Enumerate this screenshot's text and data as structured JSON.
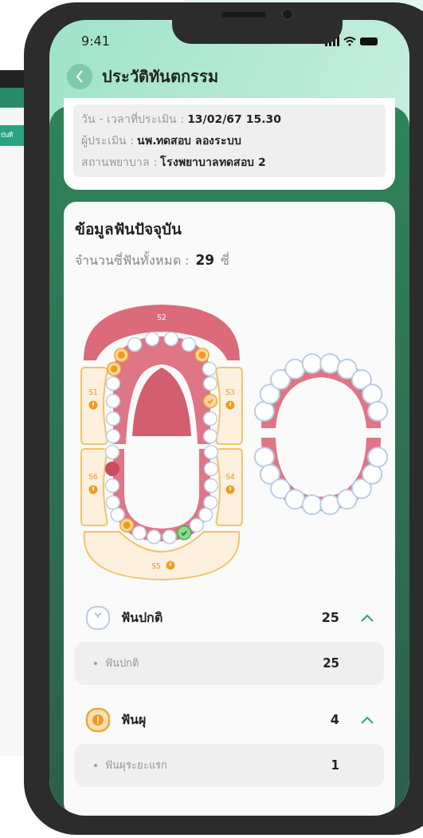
{
  "background_device": {
    "button_label": "บันทึ"
  },
  "status_bar": {
    "time": "9:41"
  },
  "header": {
    "title": "ประวัติทันตกรรม"
  },
  "info": [
    {
      "label": "วัน - เวลาที่ประเมิน :",
      "value": "13/02/67 15.30"
    },
    {
      "label": "ผู้ประเมิน :",
      "value": "นพ.ทดสอบ ลองระบบ"
    },
    {
      "label": "สถานพยาบาล :",
      "value": "โรงพยาบาลทดสอบ 2"
    }
  ],
  "teeth_card": {
    "title": "ข้อมูลฟันปัจจุบัน",
    "count_label": "จำนวนซี่ฟันทั้งหมด :",
    "count": "29",
    "unit": "ซี่"
  },
  "chart": {
    "segments": [
      {
        "label": "S2",
        "kind": "filled",
        "alert": false
      },
      {
        "label": "S1",
        "kind": "outline",
        "alert": true
      },
      {
        "label": "S3",
        "kind": "outline",
        "alert": true
      },
      {
        "label": "S6",
        "kind": "outline",
        "alert": true
      },
      {
        "label": "S4",
        "kind": "outline",
        "alert": true
      },
      {
        "label": "S5",
        "kind": "outline",
        "alert": true
      }
    ],
    "upper": [
      {
        "kind": "normal"
      },
      {
        "kind": "normal"
      },
      {
        "kind": "normal"
      },
      {
        "kind": "normal"
      },
      {
        "kind": "caries"
      },
      {
        "kind": "caries"
      },
      {
        "kind": "normal"
      },
      {
        "kind": "normal"
      },
      {
        "kind": "normal"
      },
      {
        "kind": "normal"
      },
      {
        "kind": "caries"
      },
      {
        "kind": "normal"
      },
      {
        "kind": "normal"
      },
      {
        "kind": "treated"
      },
      {
        "kind": "normal"
      },
      {
        "kind": "normal"
      }
    ],
    "lower": [
      {
        "kind": "normal"
      },
      {
        "kind": "missing"
      },
      {
        "kind": "normal"
      },
      {
        "kind": "normal"
      },
      {
        "kind": "normal"
      },
      {
        "kind": "caries"
      },
      {
        "kind": "normal"
      },
      {
        "kind": "normal"
      },
      {
        "kind": "normal"
      },
      {
        "kind": "sealed"
      },
      {
        "kind": "normal"
      },
      {
        "kind": "normal"
      },
      {
        "kind": "normal"
      },
      {
        "kind": "normal"
      },
      {
        "kind": "normal"
      },
      {
        "kind": "normal"
      }
    ]
  },
  "groups": [
    {
      "kind": "normal",
      "label": "ฟันปกติ",
      "count": "25",
      "expanded": true,
      "items": [
        {
          "label": "ฟันปกติ",
          "count": "25"
        }
      ]
    },
    {
      "kind": "caries",
      "label": "ฟันผุ",
      "count": "4",
      "expanded": true,
      "items": [
        {
          "label": "ฟันผุระยะแรก",
          "count": "1"
        }
      ]
    }
  ]
}
